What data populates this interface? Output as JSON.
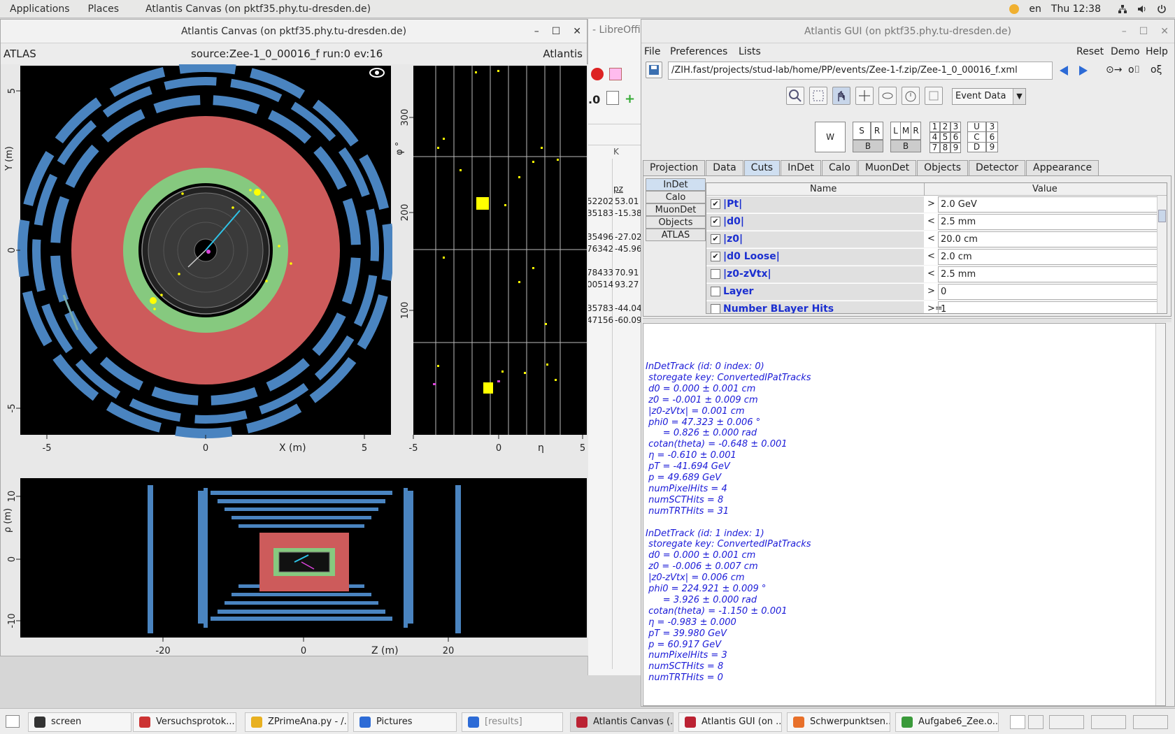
{
  "topbar": {
    "applications": "Applications",
    "places": "Places",
    "active_app": "Atlantis Canvas (on pktf35.phy.tu-dresden.de)",
    "lang": "en",
    "clock": "Thu 12:38"
  },
  "canvas_window": {
    "title": "Atlantis Canvas (on pktf35.phy.tu-dresden.de)",
    "left_label": "ATLAS",
    "source_label": "source:Zee-1_0_00016_f run:0 ev:16",
    "right_label": "Atlantis",
    "xy_ylabel": "Y (m)",
    "xy_xlabel": "X (m)",
    "xy_xticks": [
      "-5",
      "0",
      "5"
    ],
    "xy_yticks": [
      "5",
      "0",
      "-5"
    ],
    "phi_ylabel": "φ °",
    "phi_xlabel": "η",
    "phi_xticks": [
      "-5",
      "0",
      "5"
    ],
    "phi_yticks": [
      "300",
      "200",
      "100"
    ],
    "rz_ylabel": "ρ (m)",
    "rz_xlabel": "Z (m)",
    "rz_xticks": [
      "-20",
      "0",
      "20"
    ],
    "rz_yticks": [
      "10",
      "0",
      "-10"
    ]
  },
  "libreoffice": {
    "title_fragment": "- LibreOffi",
    "zoom_fragment": ".0",
    "col_k": "K",
    "col_pz": "pz",
    "rows": [
      [
        "52202",
        "53.01"
      ],
      [
        "35183",
        "-15.38"
      ],
      [
        "35496",
        "-27.02"
      ],
      [
        "76342",
        "-45.96"
      ],
      [
        "78433",
        "70.91"
      ],
      [
        "00514",
        "93.27"
      ],
      [
        "35783",
        "-44.04"
      ],
      [
        "47156",
        "-60.09"
      ]
    ]
  },
  "gui_window": {
    "title": "Atlantis GUI (on pktf35.phy.tu-dresden.de)",
    "menu": {
      "file": "File",
      "preferences": "Preferences",
      "lists": "Lists",
      "reset": "Reset",
      "demo": "Demo",
      "help": "Help"
    },
    "url": "/ZIH.fast/projects/stud-lab/home/PP/events/Zee-1-f.zip/Zee-1_0_00016_f.xml",
    "event_data_select": "Event Data",
    "window_buttons": {
      "w": "W",
      "s": "S",
      "r": "R",
      "b": "B",
      "l": "L",
      "m": "M",
      "r2": "R",
      "b2": "B",
      "grid": [
        "1",
        "2",
        "3",
        "4",
        "5",
        "6",
        "7",
        "8",
        "9"
      ],
      "u": "U",
      "3": "3",
      "c": "C",
      "6": "6",
      "d": "D",
      "9": "9"
    },
    "tabs": [
      "Projection",
      "Data",
      "Cuts",
      "InDet",
      "Calo",
      "MuonDet",
      "Objects",
      "Detector",
      "Appearance"
    ],
    "selected_tab": "Cuts",
    "side_tabs": [
      "InDet",
      "Calo",
      "MuonDet",
      "Objects",
      "ATLAS"
    ],
    "cuts_header": {
      "name": "Name",
      "value": "Value"
    },
    "cuts": [
      {
        "checked": true,
        "name": "|Pt|",
        "op": ">",
        "value": "2.0 GeV"
      },
      {
        "checked": true,
        "name": "|d0|",
        "op": "<",
        "value": "2.5 mm"
      },
      {
        "checked": true,
        "name": "|z0|",
        "op": "<",
        "value": "20.0 cm"
      },
      {
        "checked": true,
        "name": "|d0 Loose|",
        "op": "<",
        "value": "2.0 cm"
      },
      {
        "checked": false,
        "name": "|z0-zVtx|",
        "op": "<",
        "value": "2.5 mm"
      },
      {
        "checked": false,
        "name": "Layer",
        "op": ">",
        "value": "0"
      },
      {
        "checked": false,
        "name": "Number BLayer Hits",
        "op": ">=",
        "value": "1"
      }
    ],
    "output_lines": [
      "InDetTrack (id: 0 index: 0)",
      " storegate key: ConvertedIPatTracks",
      " d0 = 0.000 ± 0.001 cm",
      " z0 = -0.001 ± 0.009 cm",
      " |z0-zVtx| = 0.001 cm",
      " phi0 = 47.323 ± 0.006 °",
      "      = 0.826 ± 0.000 rad",
      " cotan(theta) = -0.648 ± 0.001",
      " η = -0.610 ± 0.001",
      " pT = -41.694 GeV",
      " p = 49.689 GeV",
      " numPixelHits = 4",
      " numSCTHits = 8",
      " numTRTHits = 31",
      "",
      "InDetTrack (id: 1 index: 1)",
      " storegate key: ConvertedIPatTracks",
      " d0 = 0.000 ± 0.001 cm",
      " z0 = -0.006 ± 0.007 cm",
      " |z0-zVtx| = 0.006 cm",
      " phi0 = 224.921 ± 0.009 °",
      "      = 3.926 ± 0.000 rad",
      " cotan(theta) = -1.150 ± 0.001",
      " η = -0.983 ± 0.000",
      " pT = 39.980 GeV",
      " p = 60.917 GeV",
      " numPixelHits = 3",
      " numSCTHits = 8",
      " numTRTHits = 0"
    ]
  },
  "taskbar": {
    "items": [
      {
        "label": "screen",
        "icon": "terminal-icon"
      },
      {
        "label": "Versuchsprotok...",
        "icon": "document-icon"
      },
      {
        "label": "ZPrimeAna.py - /...",
        "icon": "editor-icon"
      },
      {
        "label": "Pictures",
        "icon": "folder-icon"
      },
      {
        "label": "[results]",
        "icon": "folder-icon"
      },
      {
        "label": "Atlantis Canvas (...",
        "icon": "atlantis-icon"
      },
      {
        "label": "Atlantis GUI (on ...",
        "icon": "atlantis-icon"
      },
      {
        "label": "Schwerpunktsen...",
        "icon": "firefox-icon"
      },
      {
        "label": "Aufgabe6_Zee.o...",
        "icon": "spreadsheet-icon"
      }
    ]
  },
  "colors": {
    "calo_red": "#cd5b5b",
    "calo_green": "#86c97f",
    "muon_blue": "#4a84c0",
    "track_cyan": "#2fc4e8",
    "hits_yellow": "#ffff00",
    "gui_link_blue": "#1b2fd0"
  }
}
